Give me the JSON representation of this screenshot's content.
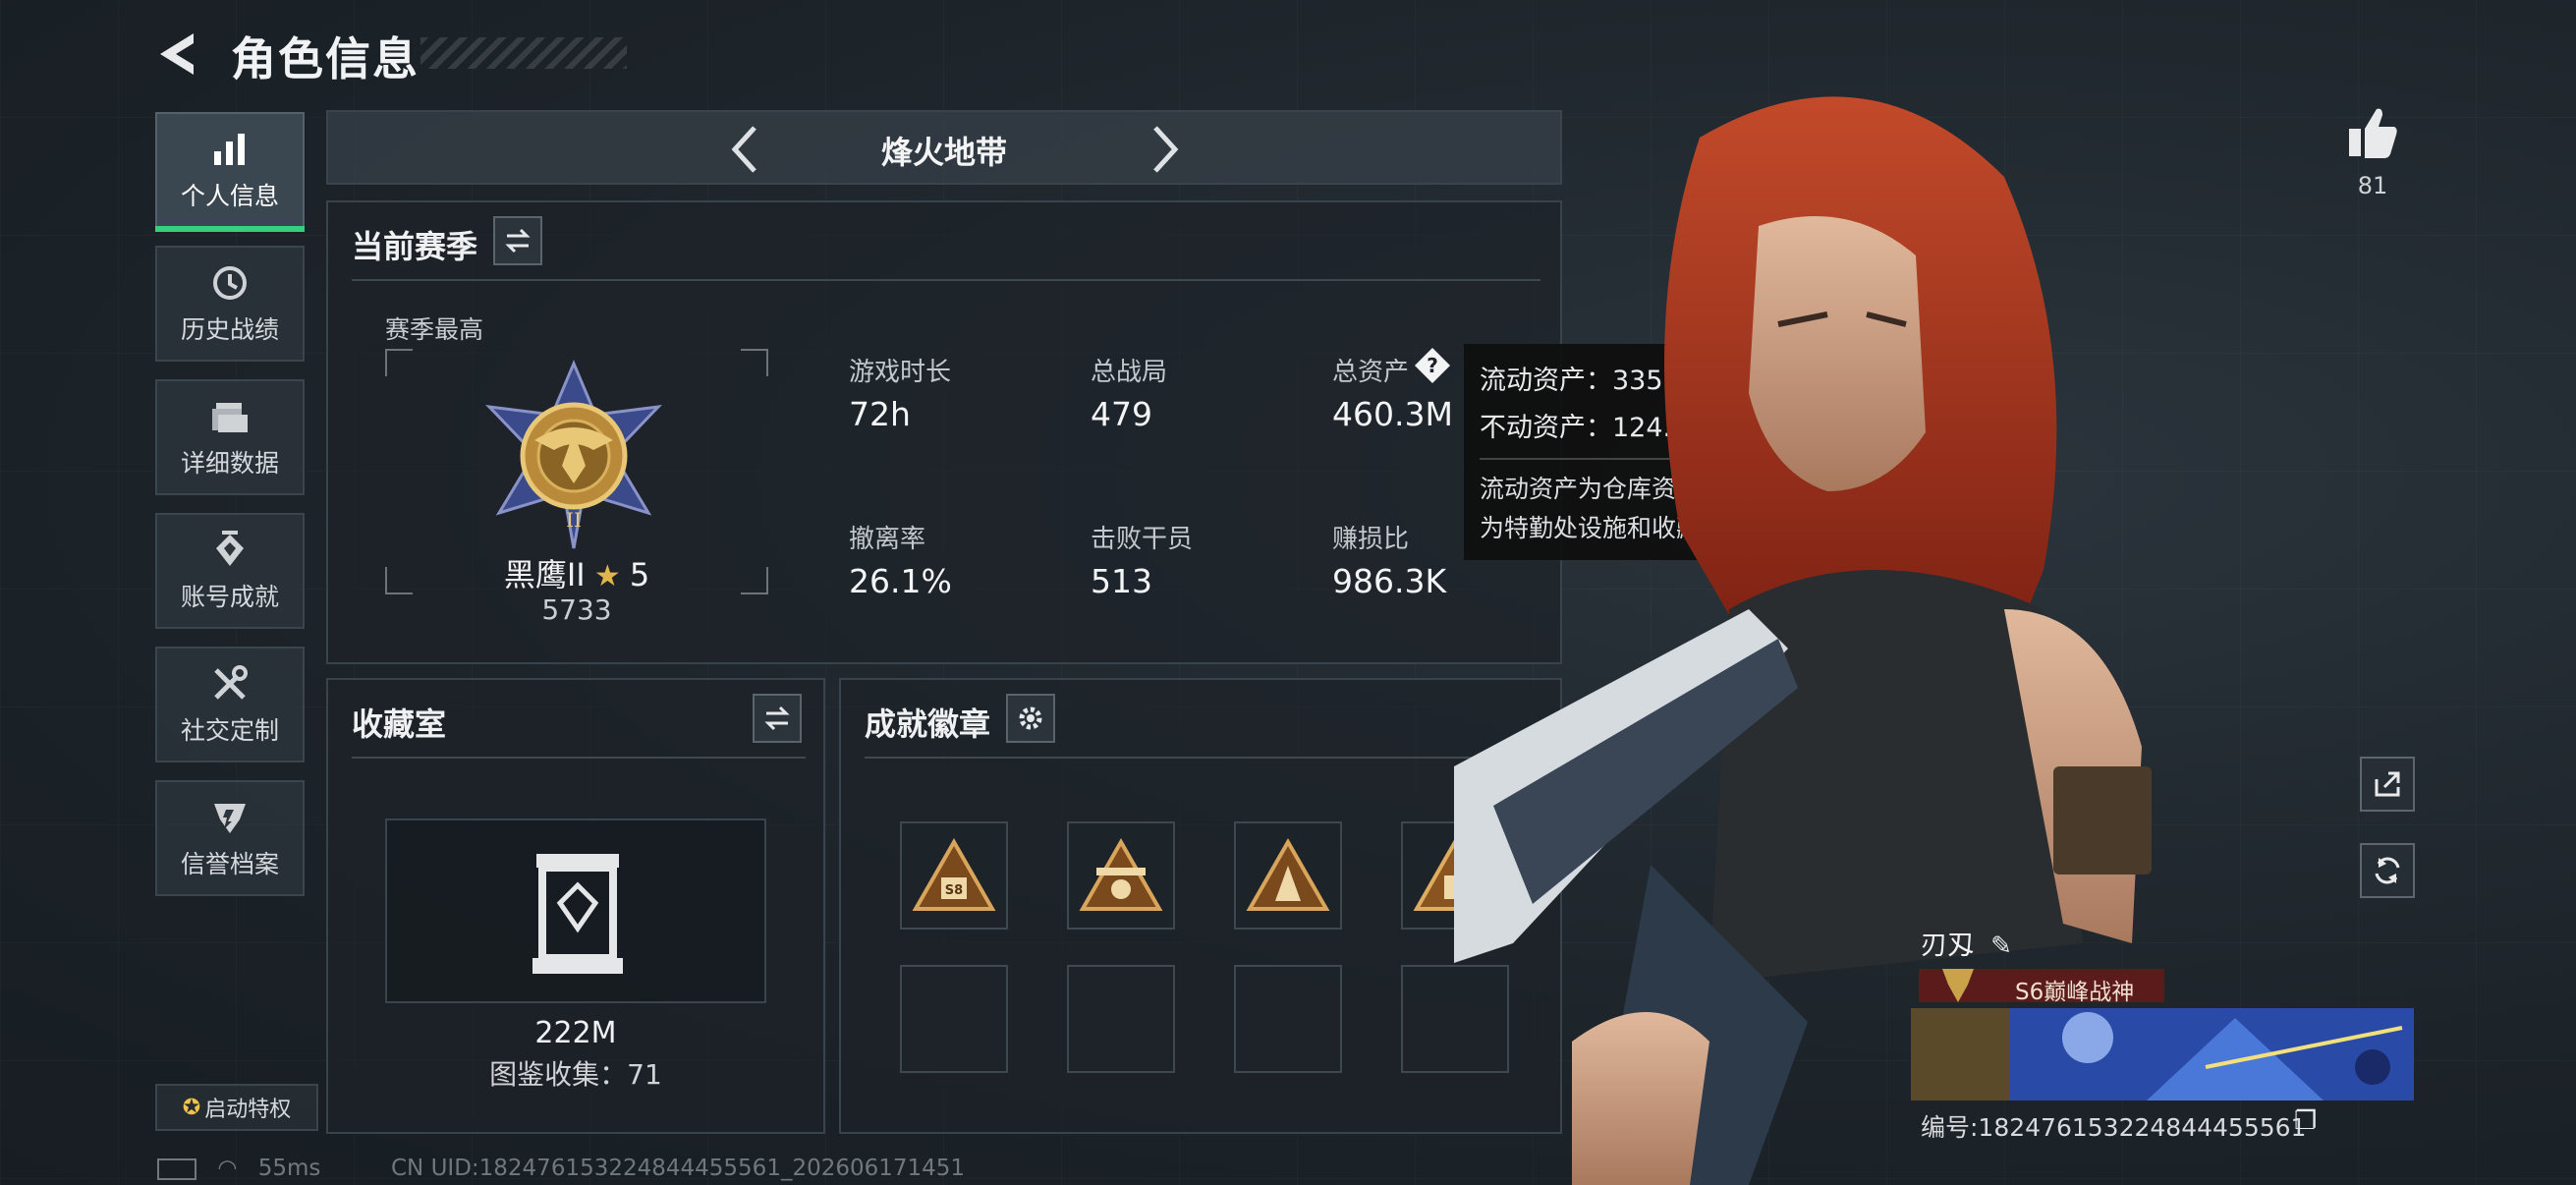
{
  "header": {
    "title": "角色信息"
  },
  "nav": {
    "items": [
      {
        "label": "个人信息",
        "icon": "bar-chart-icon",
        "active": true
      },
      {
        "label": "历史战绩",
        "icon": "history-icon"
      },
      {
        "label": "详细数据",
        "icon": "folder-icon"
      },
      {
        "label": "账号成就",
        "icon": "achievement-icon"
      },
      {
        "label": "社交定制",
        "icon": "tools-icon"
      },
      {
        "label": "信誉档案",
        "icon": "reputation-icon"
      }
    ],
    "privilege_label": "启动特权"
  },
  "mode": {
    "label": "烽火地带"
  },
  "season": {
    "title": "当前赛季",
    "best_label": "赛季最高",
    "rank_name": "黑鹰II",
    "rank_stars": "5",
    "rank_score": "5733",
    "stats": [
      {
        "label": "游戏时长",
        "value": "72h"
      },
      {
        "label": "总战局",
        "value": "479"
      },
      {
        "label": "总资产",
        "value": "460.3M"
      },
      {
        "label": "撤离率",
        "value": "26.1%"
      },
      {
        "label": "击败干员",
        "value": "513"
      },
      {
        "label": "赚损比",
        "value": "986.3K"
      }
    ]
  },
  "tooltip": {
    "liquid": "流动资产：335.9M",
    "fixed": "不动资产：124.4M",
    "note_line1": "流动资产为仓库资产和哈夫币，不动资产",
    "note_line2": "为特勤处设施和收藏室设施"
  },
  "collection": {
    "title": "收藏室",
    "value": "222M",
    "catalog": "图鉴收集：71"
  },
  "achievements": {
    "title": "成就徽章",
    "badge_text": "S8"
  },
  "like": {
    "count": "81"
  },
  "profile": {
    "name": "刃刄",
    "title": "S6巅峰战神",
    "id": "编号:182476153224844455561"
  },
  "status": {
    "ping": "55ms",
    "uid": "CN UID:182476153224844455561_202606171451"
  },
  "colors": {
    "accent_green": "#35d07f",
    "gold": "#c9a24a",
    "title_red": "#5c1b1b"
  }
}
